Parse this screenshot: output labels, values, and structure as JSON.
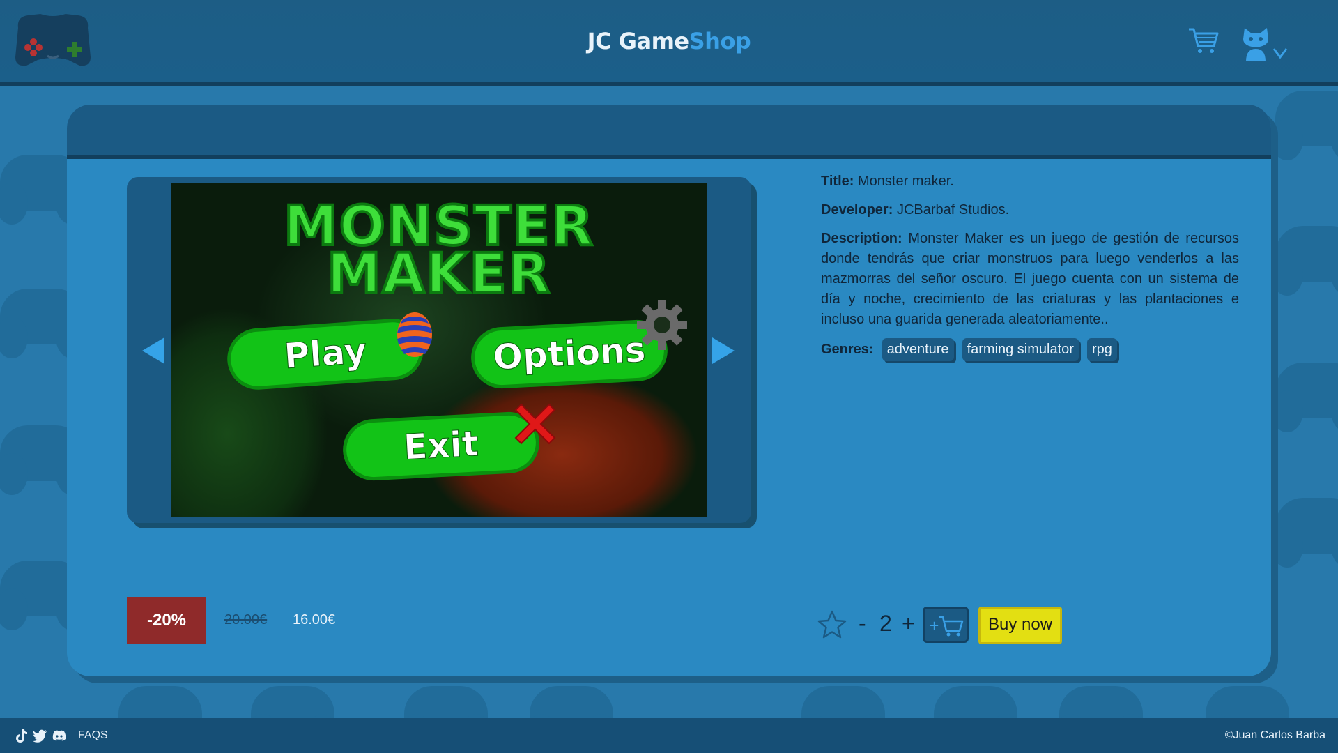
{
  "header": {
    "title_main": "JC Game",
    "title_accent": "Shop",
    "logo_icon": "gamepad-logo-icon",
    "cart_icon": "cart-icon",
    "user_icon": "cat-user-icon"
  },
  "product": {
    "screenshot": {
      "title_line1": "MONSTER",
      "title_line2": "MAKER",
      "play_label": "Play",
      "options_label": "Options",
      "exit_label": "Exit"
    },
    "title_label": "Title:",
    "title": "Monster maker.",
    "developer_label": "Developer:",
    "developer": "JCBarbaf Studios.",
    "description_label": "Description:",
    "description": "Monster Maker es un juego de gestión de recursos donde tendrás que criar monstruos para luego venderlos a las mazmorras del señor oscuro. El juego cuenta con un sistema de día y noche, crecimiento de las criaturas y las plantaciones e incluso una guarida generada aleatoriamente..",
    "genres_label": "Genres:",
    "genres": [
      "adventure",
      "farming simulator",
      "rpg"
    ]
  },
  "price": {
    "discount": "-20%",
    "old_price": "20.00€",
    "new_price": "16.00€"
  },
  "actions": {
    "quantity_minus": "-",
    "quantity": "2",
    "quantity_plus": "+",
    "buy_now": "Buy now"
  },
  "footer": {
    "faqs": "FAQS",
    "copyright": "©Juan Carlos Barba",
    "icons": [
      "tiktok-icon",
      "twitter-icon",
      "discord-icon"
    ]
  },
  "colors": {
    "header_bg": "#1d5d85",
    "card_bg": "#2a89c2",
    "accent": "#3aa0e6",
    "discount_bg": "#8f2a2a",
    "buy_bg": "#e3df12"
  }
}
